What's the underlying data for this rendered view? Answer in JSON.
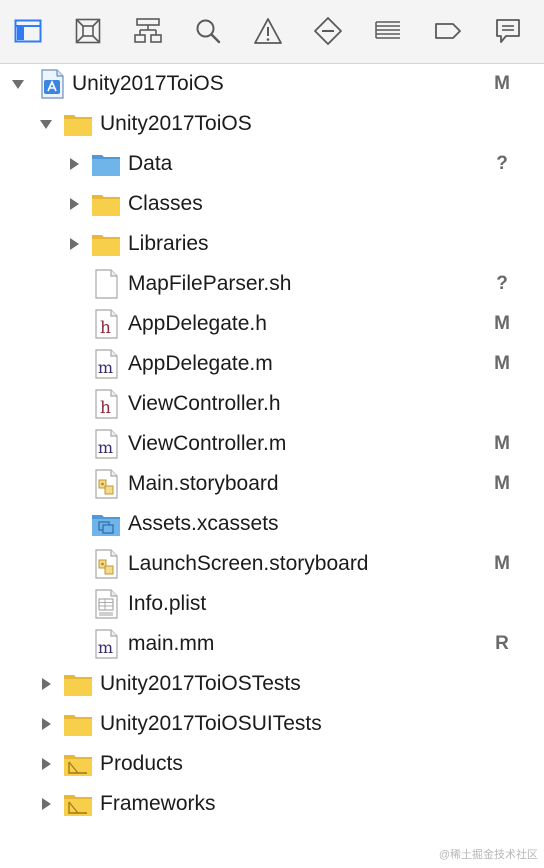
{
  "navigator_tabs": [
    {
      "name": "project-navigator",
      "icon": "folder-icon",
      "active": true
    },
    {
      "name": "source-control-navigator",
      "icon": "source-control-icon",
      "active": false
    },
    {
      "name": "symbol-navigator",
      "icon": "hierarchy-icon",
      "active": false
    },
    {
      "name": "find-navigator",
      "icon": "search-icon",
      "active": false
    },
    {
      "name": "issue-navigator",
      "icon": "warning-icon",
      "active": false
    },
    {
      "name": "test-navigator",
      "icon": "test-diamond-icon",
      "active": false
    },
    {
      "name": "debug-navigator",
      "icon": "list-icon",
      "active": false
    },
    {
      "name": "breakpoint-navigator",
      "icon": "breakpoint-icon",
      "active": false
    },
    {
      "name": "report-navigator",
      "icon": "speech-bubble-icon",
      "active": false
    }
  ],
  "colors": {
    "accent": "#2f7cf6",
    "folder_yellow": "#f7cf4a",
    "folder_blue": "#6fb5ea",
    "header_icon_fill": "#6fa8e6",
    "h_letter": "#8c2b3a",
    "m_letter": "#3b2d6e",
    "status_gray": "#6a6a6a"
  },
  "tree": {
    "items": [
      {
        "label": "Unity2017ToiOS",
        "icon": "xcode-project-icon",
        "disclosure": "expanded",
        "level": 0,
        "status": "M"
      },
      {
        "label": "Unity2017ToiOS",
        "icon": "folder-icon",
        "disclosure": "expanded",
        "level": 1,
        "status": ""
      },
      {
        "label": "Data",
        "icon": "blue-folder-icon",
        "disclosure": "collapsed",
        "level": 2,
        "status": "?"
      },
      {
        "label": "Classes",
        "icon": "folder-icon",
        "disclosure": "collapsed",
        "level": 2,
        "status": ""
      },
      {
        "label": "Libraries",
        "icon": "folder-icon",
        "disclosure": "collapsed",
        "level": 2,
        "status": ""
      },
      {
        "label": "MapFileParser.sh",
        "icon": "blank-file-icon",
        "disclosure": "none",
        "level": 2,
        "status": "?"
      },
      {
        "label": "AppDelegate.h",
        "icon": "header-file-icon",
        "disclosure": "none",
        "level": 2,
        "status": "M"
      },
      {
        "label": "AppDelegate.m",
        "icon": "objc-file-icon",
        "disclosure": "none",
        "level": 2,
        "status": "M"
      },
      {
        "label": "ViewController.h",
        "icon": "header-file-icon",
        "disclosure": "none",
        "level": 2,
        "status": ""
      },
      {
        "label": "ViewController.m",
        "icon": "objc-file-icon",
        "disclosure": "none",
        "level": 2,
        "status": "M"
      },
      {
        "label": "Main.storyboard",
        "icon": "storyboard-icon",
        "disclosure": "none",
        "level": 2,
        "status": "M"
      },
      {
        "label": "Assets.xcassets",
        "icon": "asset-catalog-icon",
        "disclosure": "none",
        "level": 2,
        "status": ""
      },
      {
        "label": "LaunchScreen.storyboard",
        "icon": "storyboard-icon",
        "disclosure": "none",
        "level": 2,
        "status": "M"
      },
      {
        "label": "Info.plist",
        "icon": "plist-file-icon",
        "disclosure": "none",
        "level": 2,
        "status": ""
      },
      {
        "label": "main.mm",
        "icon": "objc-file-icon",
        "disclosure": "none",
        "level": 2,
        "status": "R"
      },
      {
        "label": "Unity2017ToiOSTests",
        "icon": "folder-icon",
        "disclosure": "collapsed",
        "level": 1,
        "status": ""
      },
      {
        "label": "Unity2017ToiOSUITests",
        "icon": "folder-icon",
        "disclosure": "collapsed",
        "level": 1,
        "status": ""
      },
      {
        "label": "Products",
        "icon": "products-folder-icon",
        "disclosure": "collapsed",
        "level": 1,
        "status": ""
      },
      {
        "label": "Frameworks",
        "icon": "products-folder-icon",
        "disclosure": "collapsed",
        "level": 1,
        "status": ""
      }
    ]
  },
  "watermark": "@稀土掘金技术社区"
}
